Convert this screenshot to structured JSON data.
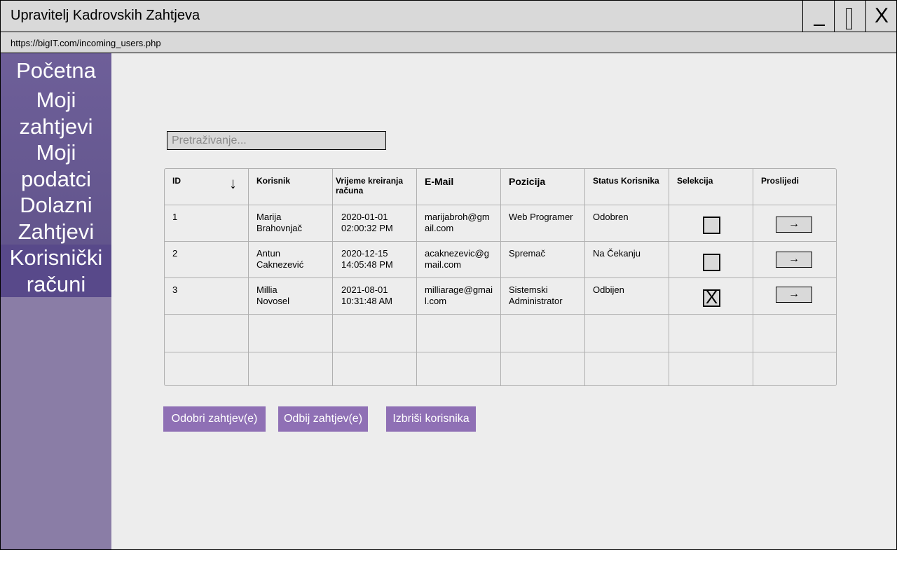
{
  "window": {
    "title": "Upravitelj Kadrovskih Zahtjeva",
    "url": "https://bigIT.com/incoming_users.php",
    "close_label": "X"
  },
  "sidebar": {
    "items": [
      {
        "label": "Početna"
      },
      {
        "label": "Moji zahtjevi"
      },
      {
        "label": "Moji podatci"
      },
      {
        "label": "Dolazni Zahtjevi"
      },
      {
        "label": "Korisnički računi"
      }
    ]
  },
  "search": {
    "placeholder": "Pretraživanje..."
  },
  "table": {
    "headers": [
      "ID",
      "Korisnik",
      "Vrijeme kreiranja računa",
      "E-Mail",
      "Pozicija",
      "Status Korisnika",
      "Selekcija",
      "Proslijedi"
    ],
    "rows": [
      {
        "id": "1",
        "user": "Marija Brahovnjač",
        "created": "2020-01-01 02:00:32 PM",
        "email": "marijabroh@gmail.com",
        "position": "Web Programer",
        "status": "Odobren",
        "selected": false
      },
      {
        "id": "2",
        "user": "Antun Caknezević",
        "created": "2020-12-15 14:05:48 PM",
        "email": "acaknezevic@gmail.com",
        "position": "Spremač",
        "status": "Na Čekanju",
        "selected": false
      },
      {
        "id": "3",
        "user": "Millia Novosel",
        "created": "2021-08-01 10:31:48 AM",
        "email": "milliarage@gmail.com",
        "position": "Sistemski Administrator",
        "status": "Odbijen",
        "selected": true
      }
    ],
    "check_mark": "X",
    "forward_arrow": "→",
    "sort_arrow": "↓"
  },
  "actions": {
    "approve": "Odobri zahtjev(e)",
    "reject": "Odbij zahtjev(e)",
    "delete": "Izbriši korisnika"
  },
  "colors": {
    "sidebar": "#8a7da6",
    "sidebar_active": "#58498a",
    "button": "#8f70b5"
  }
}
